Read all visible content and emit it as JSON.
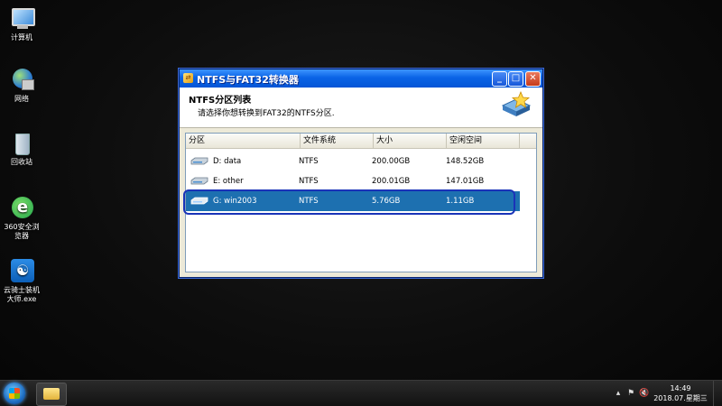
{
  "desktop": {
    "icons": [
      {
        "label": "计算机",
        "icon": "computer-icon"
      },
      {
        "label": "网络",
        "icon": "network-icon"
      },
      {
        "label": "回收站",
        "icon": "recycle-bin-icon"
      },
      {
        "label": "360安全浏览器",
        "icon": "browser-360-icon"
      },
      {
        "label": "云骑士装机大师.exe",
        "icon": "yunqishi-icon"
      }
    ]
  },
  "window": {
    "title": "NTFS与FAT32转换器",
    "header_title": "NTFS分区列表",
    "header_subtitle": "请选择你想转换到FAT32的NTFS分区.",
    "columns": [
      "分区",
      "文件系统",
      "大小",
      "空闲空间"
    ],
    "rows": [
      {
        "partition": "D: data",
        "fs": "NTFS",
        "size": "200.00GB",
        "free": "148.52GB",
        "selected": false
      },
      {
        "partition": "E: other",
        "fs": "NTFS",
        "size": "200.01GB",
        "free": "147.01GB",
        "selected": false
      },
      {
        "partition": "G: win2003",
        "fs": "NTFS",
        "size": "5.76GB",
        "free": "1.11GB",
        "selected": true
      }
    ]
  },
  "taskbar": {
    "time": "14:49",
    "date": "2018.07.星期三"
  },
  "colors": {
    "selection": "#1d70b0",
    "highlight_ring": "#1a33b8",
    "titlebar": "#0a64e6"
  }
}
